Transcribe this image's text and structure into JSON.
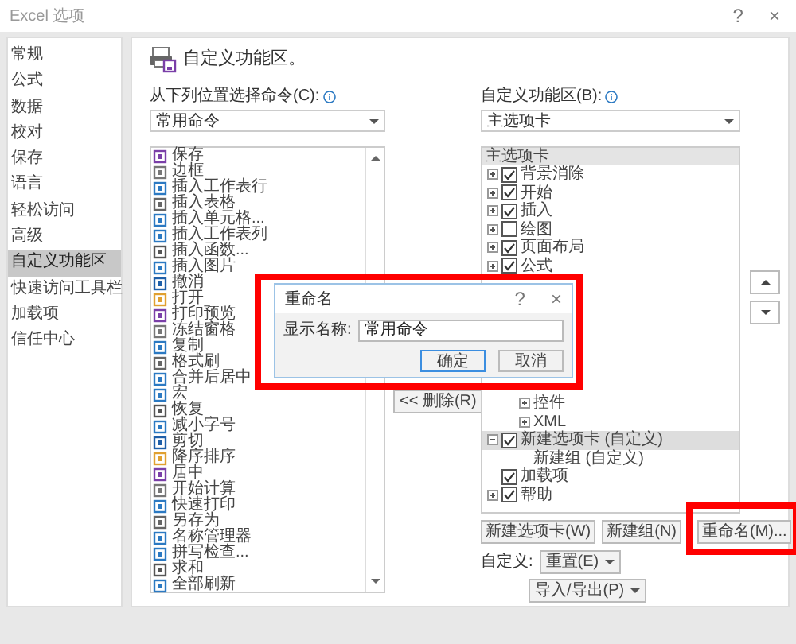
{
  "window": {
    "title": "Excel 选项",
    "help": "?",
    "close": "×"
  },
  "sidebar": {
    "items": [
      {
        "label": "常规",
        "selected": false
      },
      {
        "label": "公式",
        "selected": false
      },
      {
        "label": "数据",
        "selected": false
      },
      {
        "label": "校对",
        "selected": false
      },
      {
        "label": "保存",
        "selected": false
      },
      {
        "label": "语言",
        "selected": false
      },
      {
        "label": "轻松访问",
        "selected": false
      },
      {
        "label": "高级",
        "selected": false
      },
      {
        "label": "自定义功能区",
        "selected": true
      },
      {
        "label": "快速访问工具栏",
        "selected": false
      },
      {
        "label": "加载项",
        "selected": false
      },
      {
        "label": "信任中心",
        "selected": false
      }
    ]
  },
  "header": {
    "title": "自定义功能区。"
  },
  "commands": {
    "label": "从下列位置选择命令(C):",
    "dropdown": "常用命令",
    "items": [
      "保存",
      "边框",
      "插入工作表行",
      "插入表格",
      "插入单元格...",
      "插入工作表列",
      "插入函数...",
      "插入图片",
      "撤消",
      "打开",
      "打印预览",
      "冻结窗格",
      "复制",
      "格式刷",
      "合并后居中",
      "宏",
      "恢复",
      "减小字号",
      "剪切",
      "降序排序",
      "居中",
      "开始计算",
      "快速打印",
      "另存为",
      "名称管理器",
      "拼写检查...",
      "求和",
      "全部刷新"
    ]
  },
  "remove_button": "<< 删除(R)",
  "ribbon": {
    "label": "自定义功能区(B):",
    "dropdown": "主选项卡",
    "tree_header": "主选项卡",
    "tree": [
      {
        "label": "背景消除",
        "kind": "tab",
        "expanded": false,
        "checked": true,
        "selected": false
      },
      {
        "label": "开始",
        "kind": "tab",
        "expanded": false,
        "checked": true,
        "selected": false
      },
      {
        "label": "插入",
        "kind": "tab",
        "expanded": false,
        "checked": true,
        "selected": false
      },
      {
        "label": "绘图",
        "kind": "tab",
        "expanded": false,
        "checked": false,
        "selected": false
      },
      {
        "label": "页面布局",
        "kind": "tab",
        "expanded": false,
        "checked": true,
        "selected": false
      },
      {
        "label": "公式",
        "kind": "tab",
        "expanded": false,
        "checked": true,
        "selected": false
      }
    ],
    "tree_below": [
      {
        "label": "控件",
        "kind": "group",
        "expanded": false,
        "selected": false
      },
      {
        "label": "XML",
        "kind": "group",
        "expanded": false,
        "selected": false
      },
      {
        "label": "新建选项卡 (自定义)",
        "kind": "tab",
        "expanded": true,
        "checked": true,
        "selected": true,
        "children": [
          {
            "label": "新建组 (自定义)",
            "kind": "group",
            "selected": false
          }
        ]
      },
      {
        "label": "加载项",
        "kind": "tab",
        "checked": true,
        "selected": false
      },
      {
        "label": "帮助",
        "kind": "tab",
        "expanded": false,
        "checked": true,
        "selected": false
      }
    ]
  },
  "tree_buttons": [
    "新建选项卡(W)",
    "新建组(N)",
    "重命名(M)..."
  ],
  "customize": {
    "label": "自定义:",
    "reset": "重置(E)",
    "import_export": "导入/导出(P)"
  },
  "rename_dialog": {
    "title": "重命名",
    "help": "?",
    "close": "×",
    "field_label": "显示名称:",
    "value": "常用命令",
    "buttons": [
      {
        "label": "确定",
        "default": true
      },
      {
        "label": "取消",
        "default": false
      }
    ]
  }
}
